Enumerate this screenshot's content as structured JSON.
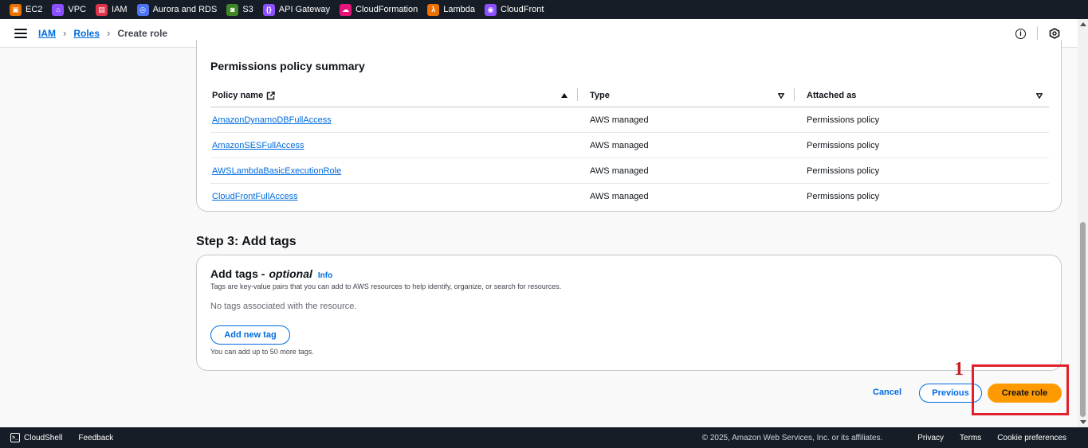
{
  "favorites": [
    {
      "label": "EC2",
      "icon": "ec2-icon",
      "color": "#ed7100"
    },
    {
      "label": "VPC",
      "icon": "vpc-icon",
      "color": "#8c4fff"
    },
    {
      "label": "IAM",
      "icon": "iam-icon",
      "color": "#dd344c"
    },
    {
      "label": "Aurora and RDS",
      "icon": "rds-icon",
      "color": "#4d72f3"
    },
    {
      "label": "S3",
      "icon": "s3-icon",
      "color": "#3f8624"
    },
    {
      "label": "API Gateway",
      "icon": "api-gateway-icon",
      "color": "#8c4fff"
    },
    {
      "label": "CloudFormation",
      "icon": "cloudformation-icon",
      "color": "#e7157b"
    },
    {
      "label": "Lambda",
      "icon": "lambda-icon",
      "color": "#ed7100"
    },
    {
      "label": "CloudFront",
      "icon": "cloudfront-icon",
      "color": "#8c4fff"
    }
  ],
  "breadcrumb": {
    "items": [
      "IAM",
      "Roles"
    ],
    "current": "Create role"
  },
  "permissions": {
    "title": "Permissions policy summary",
    "columns": [
      "Policy name",
      "Type",
      "Attached as"
    ],
    "rows": [
      {
        "name": "AmazonDynamoDBFullAccess",
        "type": "AWS managed",
        "attached": "Permissions policy"
      },
      {
        "name": "AmazonSESFullAccess",
        "type": "AWS managed",
        "attached": "Permissions policy"
      },
      {
        "name": "AWSLambdaBasicExecutionRole",
        "type": "AWS managed",
        "attached": "Permissions policy"
      },
      {
        "name": "CloudFrontFullAccess",
        "type": "AWS managed",
        "attached": "Permissions policy"
      }
    ]
  },
  "step3": {
    "title": "Step 3: Add tags",
    "panel_title": "Add tags -",
    "panel_optional": "optional",
    "info": "Info",
    "description": "Tags are key-value pairs that you can add to AWS resources to help identify, organize, or search for resources.",
    "empty": "No tags associated with the resource.",
    "add_button": "Add new tag",
    "limit": "You can add up to 50 more tags."
  },
  "actions": {
    "cancel": "Cancel",
    "previous": "Previous",
    "create": "Create role"
  },
  "annotation": {
    "number": "1",
    "color": "#e0202a"
  },
  "footer": {
    "cloudshell": "CloudShell",
    "feedback": "Feedback",
    "copyright": "© 2025, Amazon Web Services, Inc. or its affiliates.",
    "links": [
      "Privacy",
      "Terms",
      "Cookie preferences"
    ]
  },
  "colors": {
    "accent": "#006ce0",
    "primary_button": "#ff9900",
    "nav": "#161d26"
  }
}
